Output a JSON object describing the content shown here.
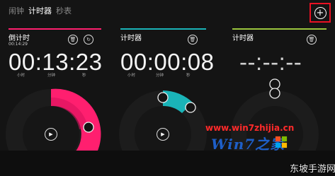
{
  "nav": {
    "tabs": [
      "闹钟",
      "计时器",
      "秒表"
    ],
    "active": 1
  },
  "add_symbol": "+",
  "panels": [
    {
      "title": "倒计时",
      "subtitle": "00:14:29",
      "time": "00:13:23",
      "units": [
        "小时",
        "分钟",
        "秒"
      ],
      "accent": "#ff1f6f",
      "progress": 0.46,
      "controls": [
        "delete-icon",
        "reset-icon"
      ]
    },
    {
      "title": "计时器",
      "time": "00:00:08",
      "units": [
        "小时",
        "分钟",
        "秒"
      ],
      "accent": "#1ab4b8",
      "progress": 0.15,
      "controls": [
        "delete-icon"
      ]
    },
    {
      "title": "计时器",
      "time": "--:--:--",
      "accent": "#9bc53d",
      "progress": 0,
      "controls": [
        "delete-icon"
      ]
    }
  ],
  "watermark": {
    "url": "www.win7zhijia.cn",
    "logo_text": "Win7之家"
  },
  "brand": "东坡手游网"
}
